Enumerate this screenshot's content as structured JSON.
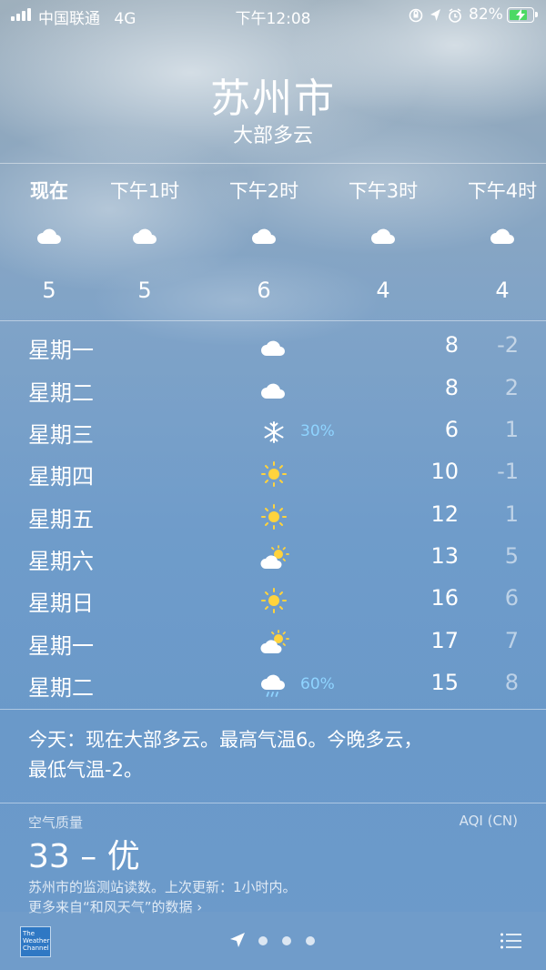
{
  "status_bar": {
    "carrier": "中国联通",
    "network": "4G",
    "time": "下午12:08",
    "battery_percent": "82%",
    "battery_level": 0.82,
    "icons": [
      "orientation-lock-icon",
      "location-arrow-icon",
      "alarm-icon",
      "battery-charging-icon"
    ]
  },
  "header": {
    "city": "苏州市",
    "condition": "大部多云"
  },
  "hourly": [
    {
      "time": "现在",
      "icon": "cloud-icon",
      "temp": "5"
    },
    {
      "time": "下午1时",
      "icon": "cloud-icon",
      "temp": "5"
    },
    {
      "time": "下午2时",
      "icon": "cloud-icon",
      "temp": "6"
    },
    {
      "time": "下午3时",
      "icon": "cloud-icon",
      "temp": "4"
    },
    {
      "time": "下午4时",
      "icon": "cloud-icon",
      "temp": "4"
    }
  ],
  "daily": [
    {
      "day": "星期一",
      "icon": "cloud-icon",
      "precip": "",
      "high": "8",
      "low": "-2"
    },
    {
      "day": "星期二",
      "icon": "cloud-icon",
      "precip": "",
      "high": "8",
      "low": "2"
    },
    {
      "day": "星期三",
      "icon": "snowflake-icon",
      "precip": "30%",
      "high": "6",
      "low": "1"
    },
    {
      "day": "星期四",
      "icon": "sun-icon",
      "precip": "",
      "high": "10",
      "low": "-1"
    },
    {
      "day": "星期五",
      "icon": "sun-icon",
      "precip": "",
      "high": "12",
      "low": "1"
    },
    {
      "day": "星期六",
      "icon": "partly-cloudy-icon",
      "precip": "",
      "high": "13",
      "low": "5"
    },
    {
      "day": "星期日",
      "icon": "sun-icon",
      "precip": "",
      "high": "16",
      "low": "6"
    },
    {
      "day": "星期一",
      "icon": "partly-cloudy-icon",
      "precip": "",
      "high": "17",
      "low": "7"
    },
    {
      "day": "星期二",
      "icon": "rain-cloud-icon",
      "precip": "60%",
      "high": "15",
      "low": "8"
    }
  ],
  "summary": {
    "text_line1": "今天：现在大部多云。最高气温6。今晚多云，",
    "text_line2": "最低气温-2。"
  },
  "air_quality": {
    "label": "空气质量",
    "index_name": "AQI (CN)",
    "value": "33 – 优",
    "source": "苏州市的监测站读数。上次更新：1小时内。",
    "more_link": "更多来自“和风天气”的数据 ›"
  },
  "toolbar": {
    "logo_text": "The Weather Channel",
    "page_count": 3,
    "icons": [
      "weather-channel-logo-icon",
      "location-arrow-icon",
      "list-icon"
    ]
  },
  "colors": {
    "precip_text": "#8fd4ff",
    "sun": "#ffd33d",
    "battery_fill": "#4cd964"
  }
}
